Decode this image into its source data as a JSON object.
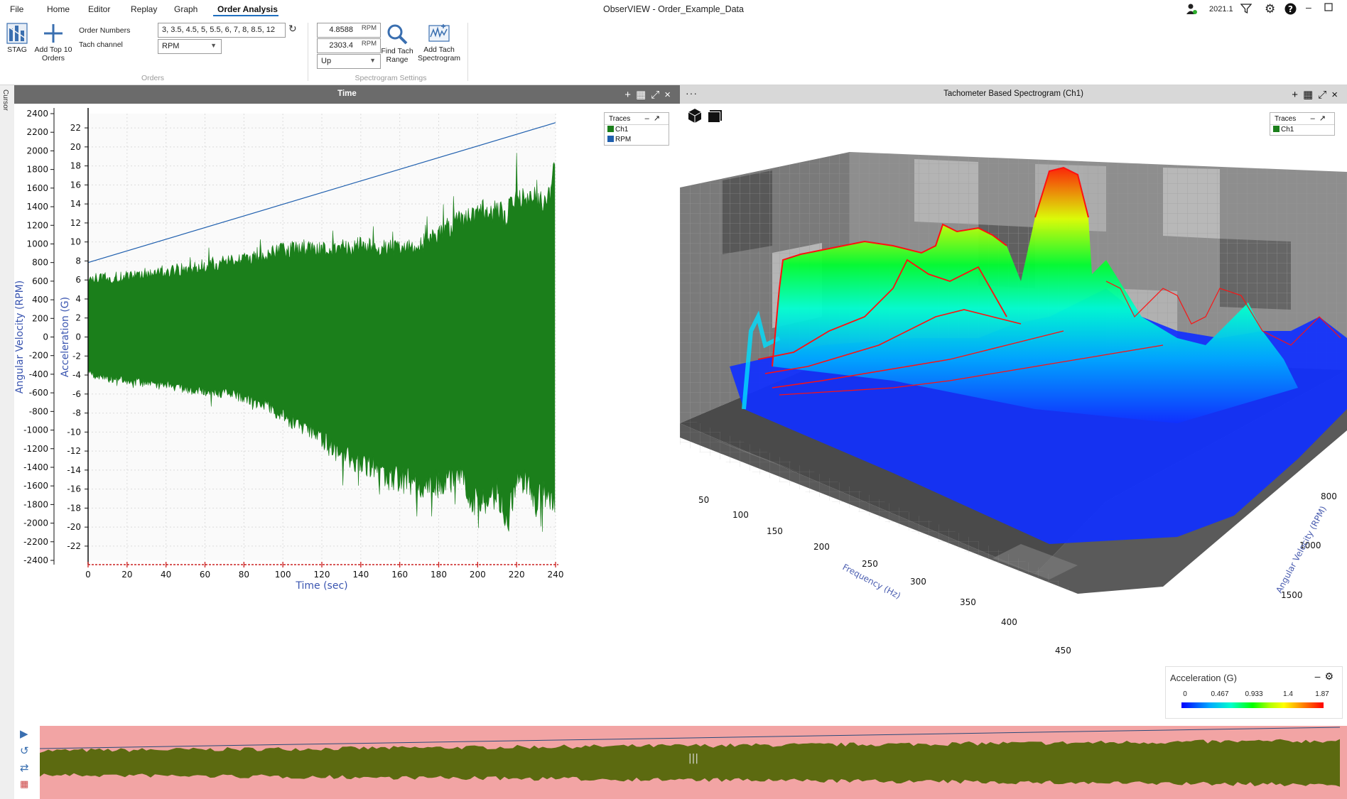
{
  "app": {
    "title": "ObserVIEW - Order_Example_Data",
    "version": "2021.1",
    "menu": [
      "File",
      "Home",
      "Editor",
      "Replay",
      "Graph",
      "Order Analysis"
    ],
    "active_menu": "Order Analysis"
  },
  "ribbon": {
    "stag_label": "STAG",
    "add_top10_label": "Add Top 10 Orders",
    "order_numbers_label": "Order Numbers",
    "order_numbers_value": "3, 3.5, 4.5, 5, 5.5, 6, 7, 8, 8.5, 12",
    "tach_channel_label": "Tach channel",
    "tach_channel_value": "RPM",
    "orders_group": "Orders",
    "rpm_min": "4.8588",
    "rpm_max": "2303.4",
    "rpm_unit": "RPM",
    "direction_value": "Up",
    "find_tach_label": "Find Tach Range",
    "add_tach_label": "Add Tach Spectrogram",
    "spectrogram_group": "Spectrogram Settings"
  },
  "cursor_strip_label": "Cursor",
  "left_panel": {
    "title": "Time",
    "legend_title": "Traces",
    "legend_items": [
      {
        "name": "Ch1",
        "color": "#1b7f1b"
      },
      {
        "name": "RPM",
        "color": "#1f5fae"
      }
    ]
  },
  "right_panel": {
    "title": "Tachometer Based Spectrogram (Ch1)",
    "legend_title": "Traces",
    "legend_items": [
      {
        "name": "Ch1",
        "color": "#1b7f1b"
      }
    ],
    "freq_axis_label": "Frequency (Hz)",
    "freq_ticks": [
      "50",
      "100",
      "150",
      "200",
      "250",
      "300",
      "350",
      "400",
      "450"
    ],
    "rpm_axis_label": "Angular Velocity (RPM)",
    "rpm_ticks": [
      "800",
      "1000",
      "1500"
    ],
    "colorbar_title": "Acceleration  (G)",
    "colorbar_ticks": [
      "0",
      "0.467",
      "0.933",
      "1.4",
      "1.87"
    ]
  },
  "chart_data": {
    "type": "line",
    "title": "Time",
    "xlabel": "Time (sec)",
    "ylabel": "Acceleration (G)",
    "y2label": "Angular Velocity (RPM)",
    "xlim": [
      0,
      240
    ],
    "ylim": [
      -23.5,
      23.5
    ],
    "y2lim": [
      -2400,
      2400
    ],
    "x_ticks": [
      0,
      20,
      40,
      60,
      80,
      100,
      120,
      140,
      160,
      180,
      200,
      220,
      240
    ],
    "y_ticks": [
      22,
      20,
      18,
      16,
      14,
      12,
      10,
      8,
      6,
      4,
      2,
      0,
      -2,
      -4,
      -6,
      -8,
      -10,
      -12,
      -14,
      -16,
      -18,
      -20,
      -22
    ],
    "y2_ticks": [
      2400,
      2200,
      2000,
      1800,
      1600,
      1400,
      1200,
      1000,
      800,
      600,
      400,
      200,
      0,
      -200,
      -400,
      -600,
      -800,
      -1000,
      -1200,
      -1400,
      -1600,
      -1800,
      -2000,
      -2200,
      -2400
    ],
    "grid": true,
    "legend_position": "top-right",
    "series": [
      {
        "name": "Ch1",
        "axis": "left",
        "color": "#1b7f1b",
        "style": "envelope",
        "x": [
          0,
          10,
          20,
          30,
          40,
          50,
          60,
          70,
          80,
          90,
          100,
          110,
          120,
          130,
          140,
          150,
          160,
          170,
          180,
          190,
          200,
          210,
          215,
          220,
          225,
          230,
          235,
          240
        ],
        "upper": [
          6.5,
          6.8,
          7.0,
          7.3,
          7.6,
          7.9,
          8.3,
          8.6,
          9.0,
          9.5,
          10.0,
          10.3,
          10.0,
          10.0,
          10.6,
          10.3,
          10.2,
          10.6,
          11.8,
          13.5,
          14.5,
          14.5,
          14.0,
          17.0,
          15.5,
          16.0,
          15.0,
          20.0
        ],
        "lower": [
          -4.2,
          -4.8,
          -5.0,
          -5.3,
          -5.5,
          -6.0,
          -6.3,
          -6.5,
          -7.0,
          -7.8,
          -9.0,
          -10.5,
          -12.0,
          -13.5,
          -14.5,
          -15.5,
          -16.5,
          -17.0,
          -17.0,
          -16.0,
          -19.5,
          -18.0,
          -21.5,
          -17.0,
          -16.5,
          -19.0,
          -18.0,
          -20.0
        ]
      },
      {
        "name": "RPM",
        "axis": "right",
        "color": "#1f5fae",
        "style": "line",
        "x": [
          0,
          240
        ],
        "y": [
          800,
          2303
        ]
      }
    ]
  }
}
